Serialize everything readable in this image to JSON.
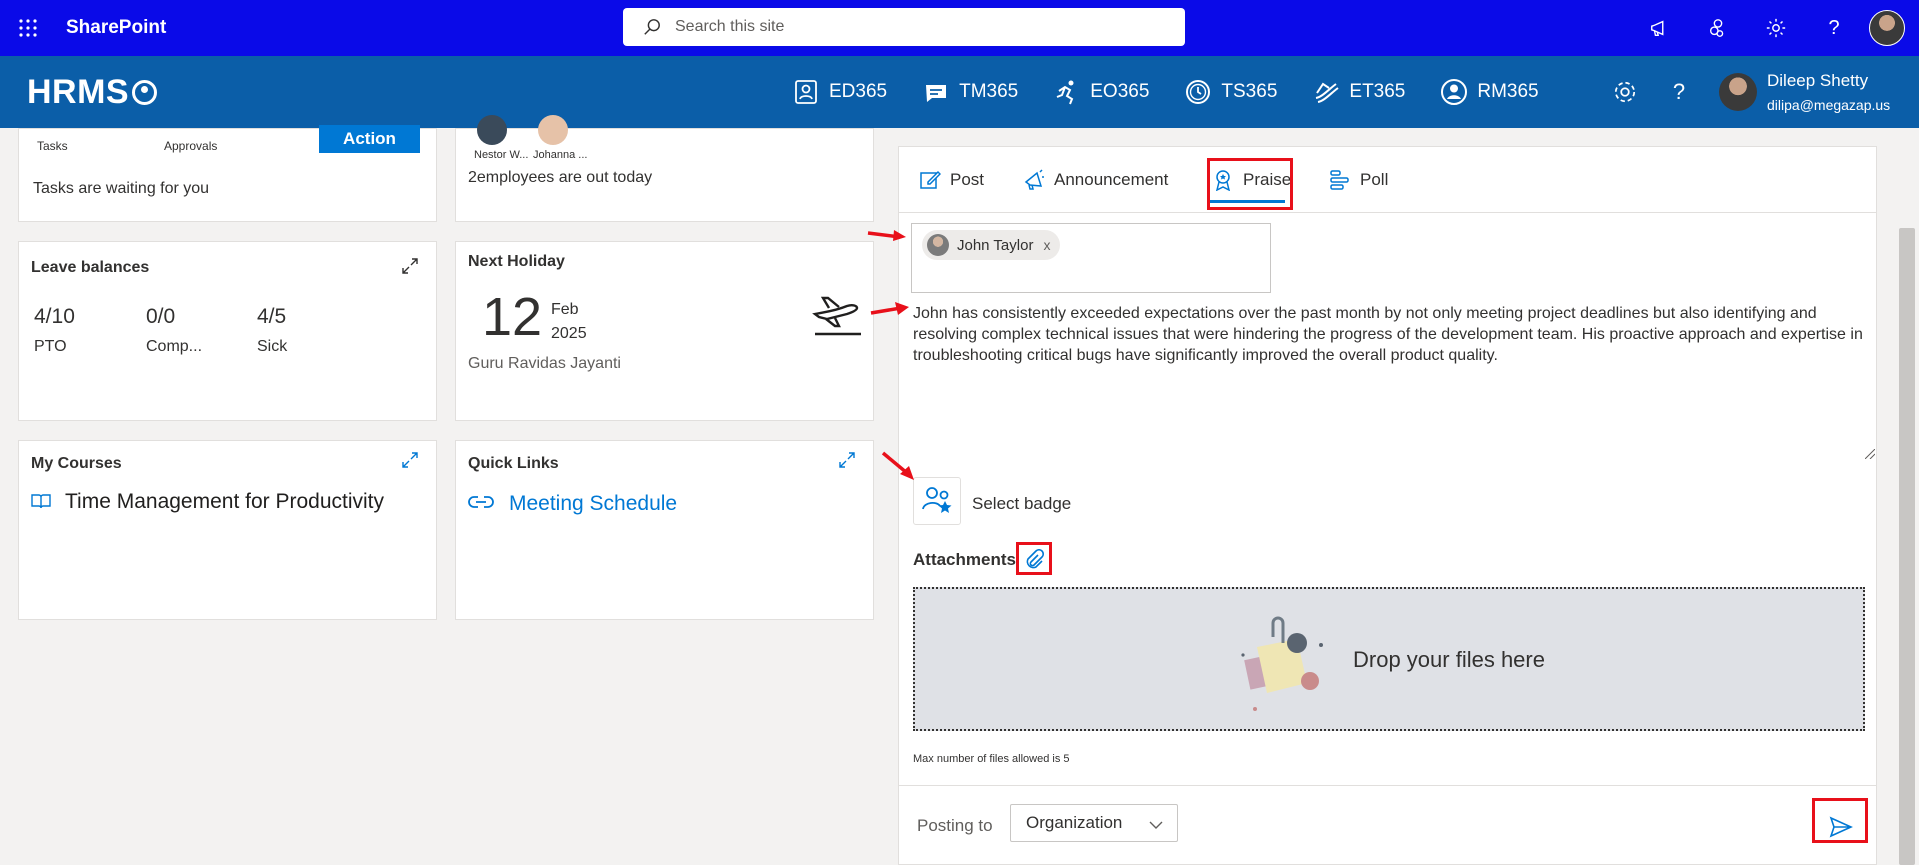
{
  "suite": {
    "app_name": "SharePoint",
    "search_placeholder": "Search this site"
  },
  "header": {
    "logo": "HRMS",
    "nav": [
      {
        "label": "ED365",
        "icon": "directory-icon"
      },
      {
        "label": "TM365",
        "icon": "chat-icon"
      },
      {
        "label": "EO365",
        "icon": "runner-icon"
      },
      {
        "label": "TS365",
        "icon": "clock-icon"
      },
      {
        "label": "ET365",
        "icon": "expense-icon"
      },
      {
        "label": "RM365",
        "icon": "person-icon"
      }
    ],
    "user": {
      "name": "Dileep Shetty",
      "email": "dilipa@megazap.us"
    }
  },
  "tasks_card": {
    "tasks_label": "Tasks",
    "approvals_label": "Approvals",
    "action_label": "Action",
    "message": "Tasks are waiting for you"
  },
  "out_card": {
    "people": [
      "Nestor W...",
      "Johanna ..."
    ],
    "message": "2employees are out today"
  },
  "leave_card": {
    "title": "Leave balances",
    "items": [
      {
        "value": "4/10",
        "label": "PTO"
      },
      {
        "value": "0/0",
        "label": "Comp..."
      },
      {
        "value": "4/5",
        "label": "Sick"
      }
    ]
  },
  "holiday_card": {
    "title": "Next Holiday",
    "day": "12",
    "month": "Feb",
    "year": "2025",
    "name": "Guru Ravidas Jayanti"
  },
  "courses_card": {
    "title": "My Courses",
    "course": "Time Management for Productivity"
  },
  "links_card": {
    "title": "Quick Links",
    "link": "Meeting Schedule"
  },
  "post_panel": {
    "tabs": [
      {
        "label": "Post",
        "icon": "edit-icon"
      },
      {
        "label": "Announcement",
        "icon": "megaphone-icon"
      },
      {
        "label": "Praise",
        "icon": "award-icon"
      },
      {
        "label": "Poll",
        "icon": "poll-icon"
      }
    ],
    "active_tab": "Praise",
    "recipient": "John Taylor",
    "recipient_remove": "x",
    "message": "John has consistently exceeded expectations over the past month by not only meeting project deadlines but also identifying and resolving complex technical issues that were hindering the progress of the development team. His proactive approach and expertise in troubleshooting critical bugs have significantly improved the overall product quality.",
    "badge_label": "Select badge",
    "attachments_label": "Attachments",
    "drop_text": "Drop your files here",
    "max_files": "Max number of files allowed is 5",
    "posting_to_label": "Posting to",
    "posting_to_value": "Organization"
  },
  "colors": {
    "suite_bar": "#0a0ae8",
    "app_bar": "#0b5ea8",
    "accent": "#0078d4",
    "highlight": "#e8101a"
  }
}
